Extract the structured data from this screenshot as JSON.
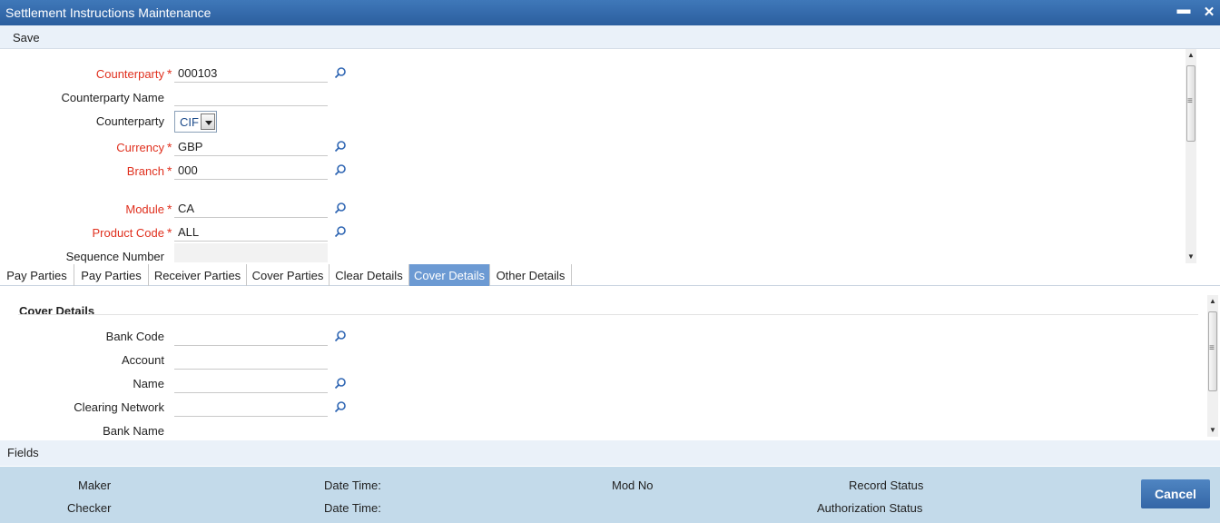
{
  "window": {
    "title": "Settlement Instructions Maintenance",
    "minimize_glyph": "▬",
    "close_glyph": "✕"
  },
  "toolbar": {
    "save_label": "Save"
  },
  "header_form": {
    "counterparty": {
      "label": "Counterparty",
      "value": "000103",
      "required": true
    },
    "counterparty_name": {
      "label": "Counterparty Name",
      "value": ""
    },
    "counterparty_type": {
      "label": "Counterparty",
      "value": "CIF"
    },
    "currency": {
      "label": "Currency",
      "value": "GBP",
      "required": true
    },
    "branch": {
      "label": "Branch",
      "value": "000",
      "required": true
    },
    "module": {
      "label": "Module",
      "value": "CA",
      "required": true
    },
    "product_code": {
      "label": "Product Code",
      "value": "ALL",
      "required": true
    },
    "sequence_number": {
      "label": "Sequence Number",
      "value": ""
    },
    "required_marker": "*"
  },
  "tabs": [
    {
      "label": "Pay Parties",
      "active": false
    },
    {
      "label": "Pay Parties",
      "active": false
    },
    {
      "label": "Receiver Parties",
      "active": false
    },
    {
      "label": "Cover Parties",
      "active": false
    },
    {
      "label": "Clear Details",
      "active": false
    },
    {
      "label": "Cover Details",
      "active": true
    },
    {
      "label": "Other Details",
      "active": false
    }
  ],
  "cover_details": {
    "section_title": "Cover Details",
    "bank_code": {
      "label": "Bank Code",
      "value": ""
    },
    "account": {
      "label": "Account",
      "value": ""
    },
    "name": {
      "label": "Name",
      "value": ""
    },
    "clearing_network": {
      "label": "Clearing Network",
      "value": ""
    },
    "bank_name": {
      "label": "Bank Name"
    }
  },
  "fields_bar": {
    "label": "Fields"
  },
  "footer": {
    "maker": "Maker",
    "checker": "Checker",
    "date_time_1": "Date Time:",
    "date_time_2": "Date Time:",
    "mod_no": "Mod No",
    "record_status": "Record Status",
    "authorization_status": "Authorization Status",
    "cancel_label": "Cancel"
  },
  "colors": {
    "title_bar": "#2b5e9e",
    "required_label": "#e0301e",
    "active_tab": "#6c9ad3",
    "footer_bg": "#c3daea",
    "cancel_button": "#3466a6"
  },
  "icons": {
    "lookup": "search-icon",
    "dropdown": "chevron-down-icon"
  }
}
